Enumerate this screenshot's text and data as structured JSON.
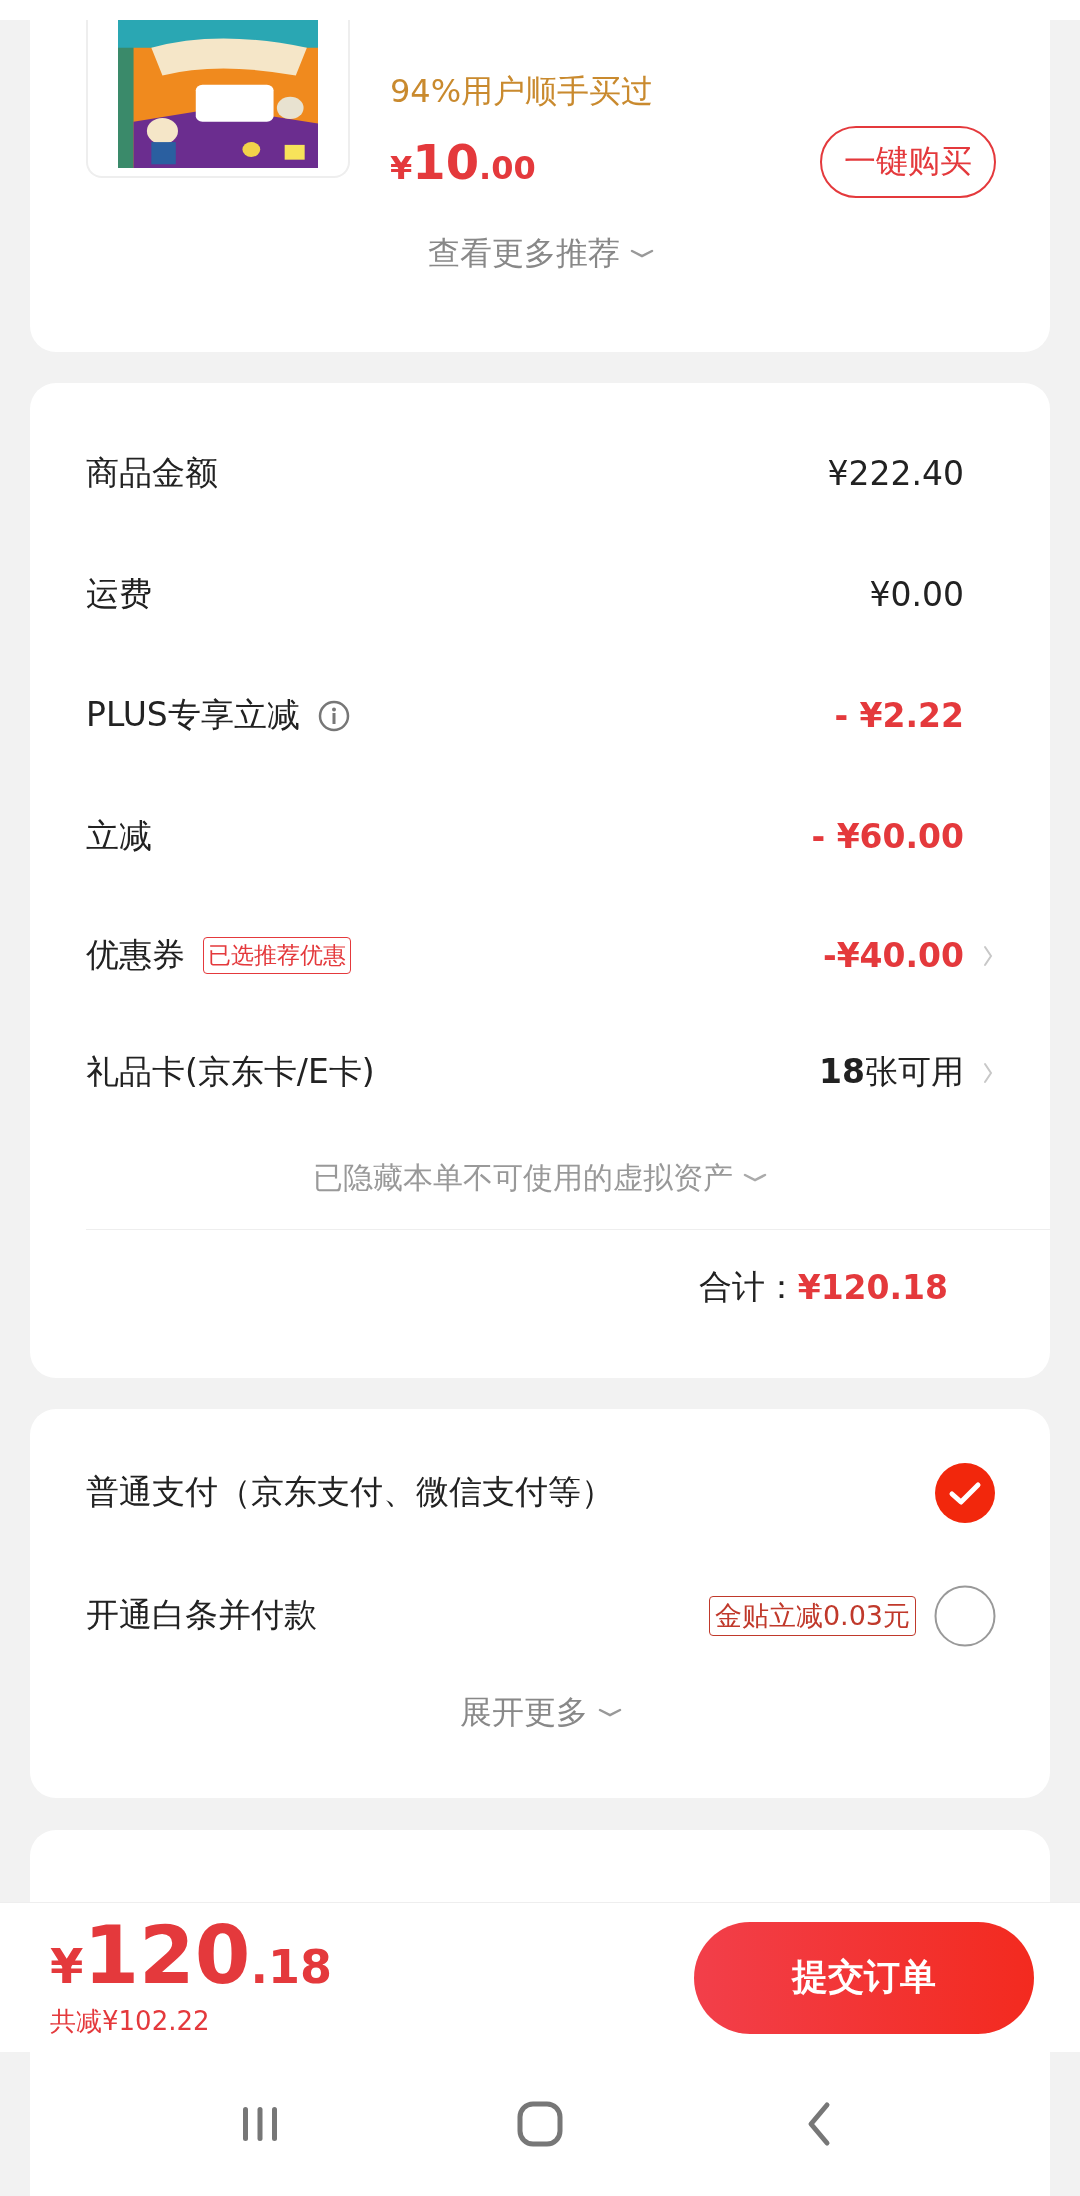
{
  "recommendation": {
    "sales_note": "94%用户顺手买过",
    "price_symbol": "¥",
    "price_int": "10",
    "price_dec": ".00",
    "buy_button": "一键购买",
    "more_link": "查看更多推荐"
  },
  "summary": {
    "rows": [
      {
        "kind": "amount",
        "label": "商品金额",
        "value": "¥222.40"
      },
      {
        "kind": "amount",
        "label": "运费",
        "value": "¥0.00"
      },
      {
        "kind": "discount",
        "label": "PLUS专享立减",
        "info": true,
        "value": "- ¥2.22"
      },
      {
        "kind": "discount",
        "label": "立减",
        "value": "- ¥60.00"
      },
      {
        "kind": "discount_link",
        "label": "优惠券",
        "tag": "已选推荐优惠",
        "value": "-¥40.00"
      },
      {
        "kind": "link",
        "label": "礼品卡(京东卡/E卡)",
        "value_bold": "18",
        "value": "张可用"
      }
    ],
    "hidden_note": "已隐藏本单不可使用的虚拟资产",
    "total_label": "合计：",
    "total_value": "¥120.18"
  },
  "payment": {
    "options": [
      {
        "label": "普通支付（京东支付、微信支付等）",
        "selected": true
      },
      {
        "label": "开通白条并付款",
        "tag": "金贴立减0.03元",
        "selected": false
      }
    ],
    "more_link": "展开更多"
  },
  "bottom_bar": {
    "price_symbol": "¥",
    "price_int": "120",
    "price_dec": ".18",
    "saved": "共减¥102.22",
    "submit_button": "提交订单"
  }
}
